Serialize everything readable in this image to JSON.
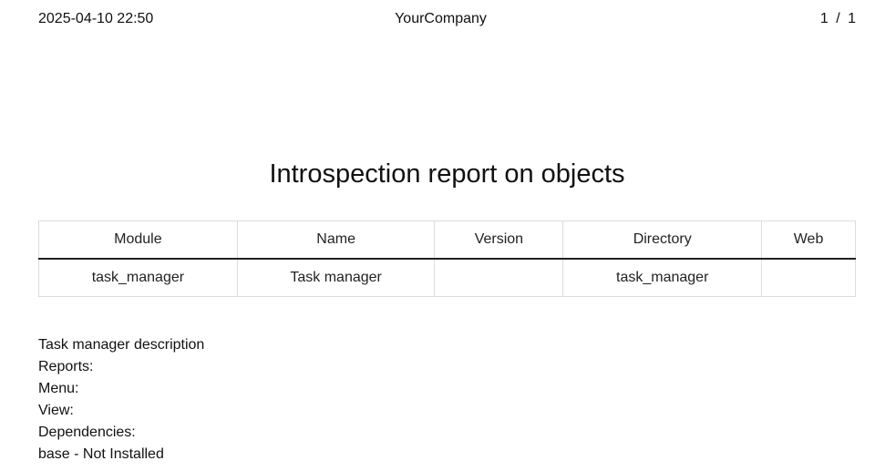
{
  "header": {
    "datetime": "2025-04-10 22:50",
    "company": "YourCompany",
    "page_current": "1",
    "page_separator": "/",
    "page_total": "1"
  },
  "report": {
    "title": "Introspection report on objects",
    "columns": [
      "Module",
      "Name",
      "Version",
      "Directory",
      "Web"
    ],
    "rows": [
      [
        "task_manager",
        "Task manager",
        "",
        "task_manager",
        ""
      ]
    ]
  },
  "details": {
    "description": "Task manager description",
    "reports_label": "Reports:",
    "menu_label": "Menu:",
    "view_label": "View:",
    "dependencies_label": "Dependencies:",
    "dependency_line": "base - Not Installed"
  }
}
